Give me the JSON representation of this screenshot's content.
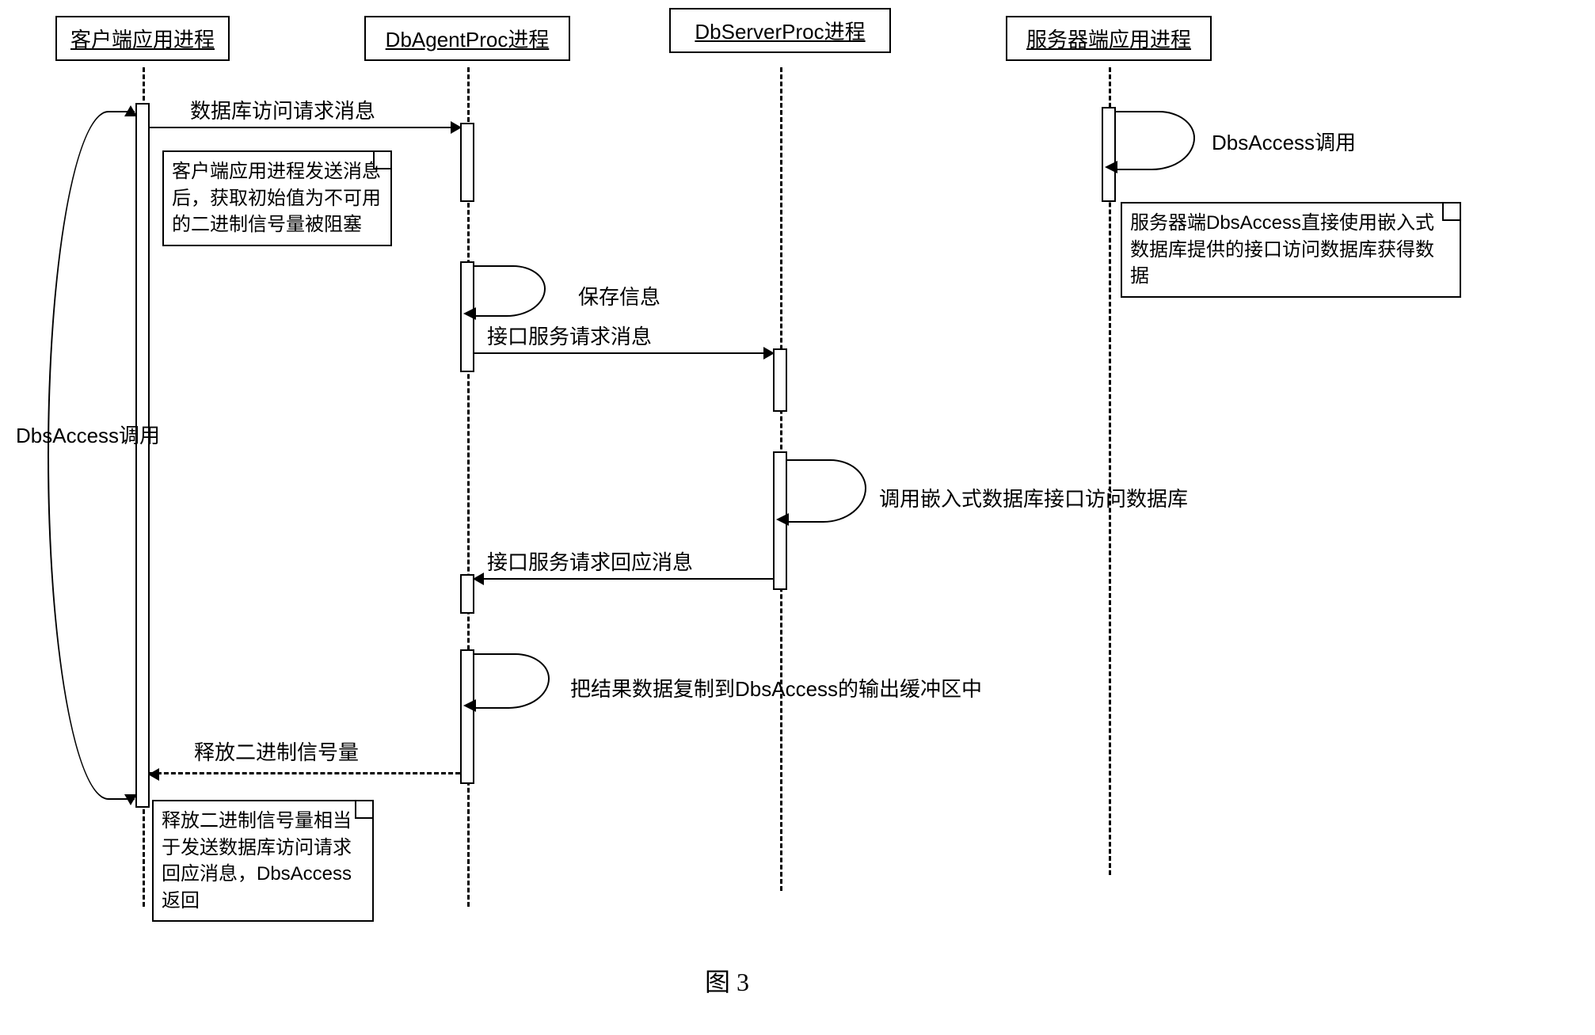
{
  "lifelines": {
    "client": "客户端应用进程",
    "agent": "DbAgentProc进程",
    "server": "DbServerProc进程",
    "serverApp": "服务器端应用进程"
  },
  "messages": {
    "dbAccessRequest": "数据库访问请求消息",
    "dbsAccessCall": "DbsAccess调用",
    "saveInfo": "保存信息",
    "interfaceServiceRequest": "接口服务请求消息",
    "callEmbeddedDb": "调用嵌入式数据库接口访问数据库",
    "interfaceServiceResponse": "接口服务请求回应消息",
    "copyResult": "把结果数据复制到DbsAccess的输出缓冲区中",
    "releaseBinarySemaphore": "释放二进制信号量",
    "dbsAccessCallRight": "DbsAccess调用"
  },
  "notes": {
    "clientNote": "客户端应用进程发送消息后，获取初始值为不可用的二进制信号量被阻塞",
    "serverAppNote": "服务器端DbsAccess直接使用嵌入式数据库提供的接口访问数据库获得数据",
    "releaseNote": "释放二进制信号量相当于发送数据库访问请求回应消息，DbsAccess返回"
  },
  "figureLabel": "图 3"
}
